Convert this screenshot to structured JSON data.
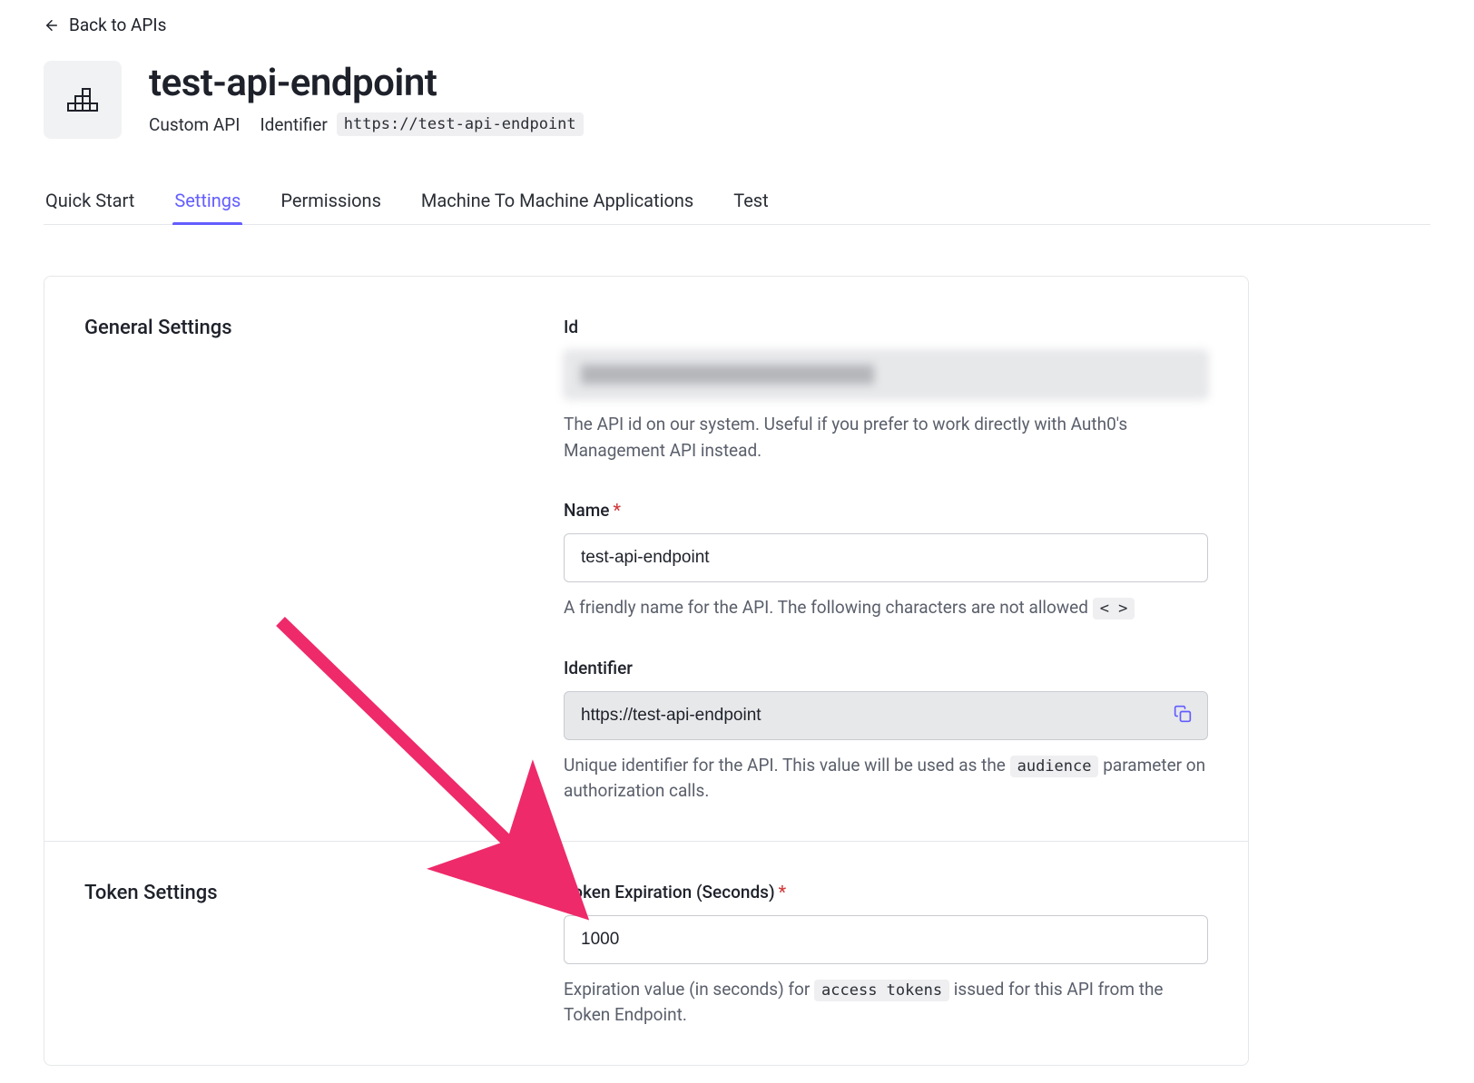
{
  "back_link": "Back to APIs",
  "header": {
    "title": "test-api-endpoint",
    "type_label": "Custom API",
    "identifier_label": "Identifier",
    "identifier_value": "https://test-api-endpoint"
  },
  "tabs": {
    "quick_start": "Quick Start",
    "settings": "Settings",
    "permissions": "Permissions",
    "m2m": "Machine To Machine Applications",
    "test": "Test",
    "active": "settings"
  },
  "sections": {
    "general": {
      "title": "General Settings",
      "fields": {
        "id": {
          "label": "Id",
          "value": "████████████████████████",
          "help": "The API id on our system. Useful if you prefer to work directly with Auth0's Management API instead."
        },
        "name": {
          "label": "Name",
          "value": "test-api-endpoint",
          "help_pre": "A friendly name for the API. The following characters are not allowed ",
          "help_code": "< >"
        },
        "identifier": {
          "label": "Identifier",
          "value": "https://test-api-endpoint",
          "help_pre": "Unique identifier for the API. This value will be used as the ",
          "help_code": "audience",
          "help_post": " parameter on authorization calls."
        }
      }
    },
    "token": {
      "title": "Token Settings",
      "fields": {
        "expiration": {
          "label": "Token Expiration (Seconds)",
          "value": "1000",
          "help_pre": "Expiration value (in seconds) for ",
          "help_code": "access tokens",
          "help_post": " issued for this API from the Token Endpoint."
        }
      }
    }
  }
}
